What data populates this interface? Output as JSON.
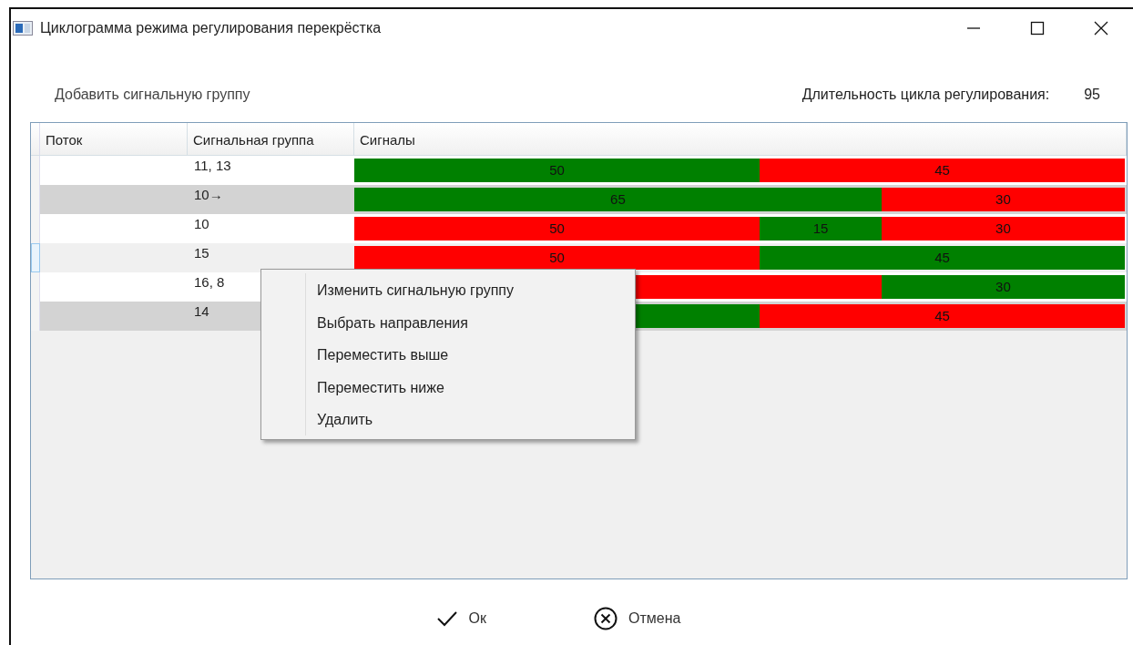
{
  "window": {
    "title": "Циклограмма режима регулирования перекрёстка"
  },
  "add_link": "Добавить сигнальную группу",
  "cycle": {
    "label": "Длительность цикла регулирования:",
    "value": "95"
  },
  "table": {
    "columns": [
      "Поток",
      "Сигнальная группа",
      "Сигналы"
    ],
    "rows": [
      {
        "group": "11, 13",
        "selected": false,
        "signals": [
          {
            "label": "50",
            "color": "#008000"
          },
          {
            "label": "45",
            "color": "#ff0000"
          }
        ]
      },
      {
        "group": "10→",
        "selected": false,
        "signals": [
          {
            "label": "65",
            "color": "#008000"
          },
          {
            "label": "30",
            "color": "#ff0000"
          }
        ]
      },
      {
        "group": "10",
        "selected": false,
        "signals": [
          {
            "label": "50",
            "color": "#ff0000"
          },
          {
            "label": "15",
            "color": "#008000"
          },
          {
            "label": "30",
            "color": "#ff0000"
          }
        ]
      },
      {
        "group": "15",
        "selected": true,
        "signals": [
          {
            "label": "50",
            "color": "#ff0000"
          },
          {
            "label": "45",
            "color": "#008000"
          }
        ]
      },
      {
        "group": "16, 8",
        "selected": false,
        "signals": [
          {
            "color": "#ff0000"
          },
          {
            "label": "30",
            "color": "#008000"
          }
        ]
      },
      {
        "group": "14",
        "selected": false,
        "signals": [
          {
            "color": "#008000"
          },
          {
            "label": "45",
            "color": "#ff0000"
          }
        ]
      }
    ]
  },
  "context_menu": [
    "Изменить сигнальную группу",
    "Выбрать направления",
    "Переместить выше",
    "Переместить ниже",
    "Удалить"
  ],
  "buttons": [
    {
      "kind": "ok",
      "label": "Ок"
    },
    {
      "kind": "cancel",
      "label": "Отмена"
    }
  ]
}
